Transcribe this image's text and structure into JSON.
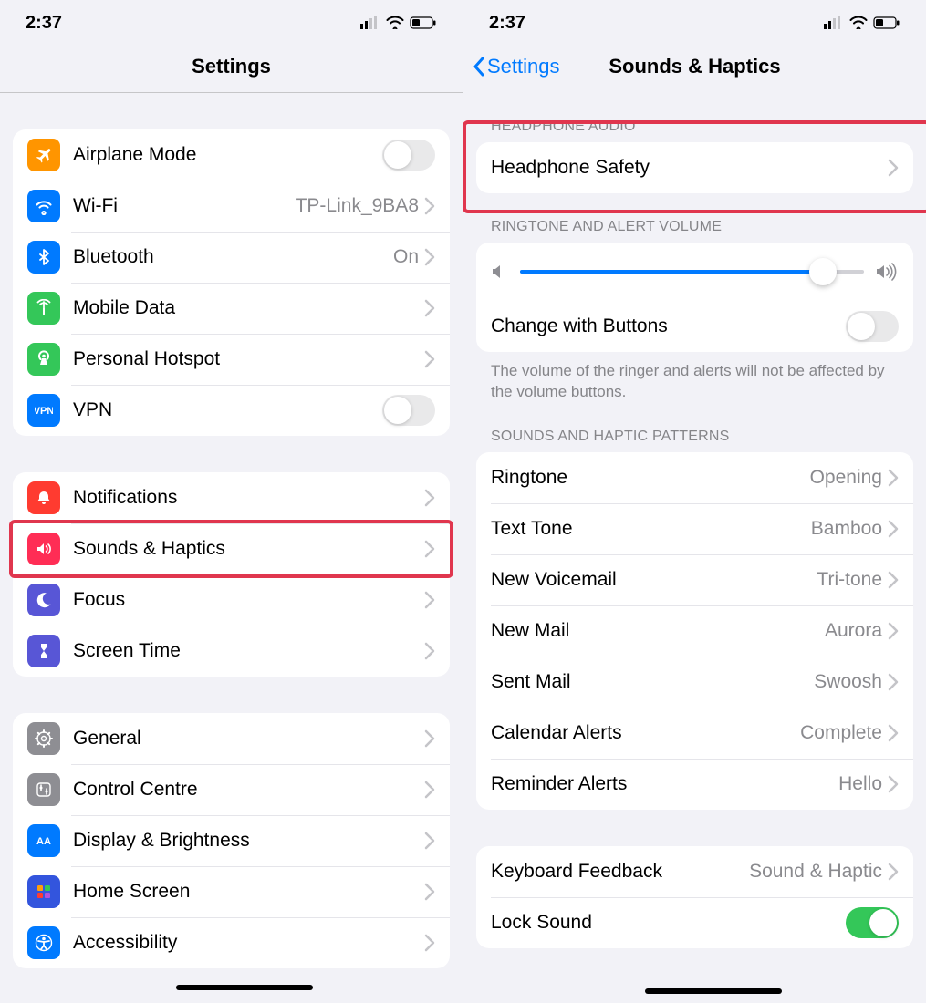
{
  "status": {
    "time": "2:37"
  },
  "left": {
    "title": "Settings",
    "groups": [
      {
        "rows": [
          {
            "key": "airplane",
            "label": "Airplane Mode",
            "type": "toggle",
            "on": false,
            "iconColor": "#ff9500"
          },
          {
            "key": "wifi",
            "label": "Wi-Fi",
            "type": "link",
            "value": "TP-Link_9BA8",
            "iconColor": "#007aff"
          },
          {
            "key": "bluetooth",
            "label": "Bluetooth",
            "type": "link",
            "value": "On",
            "iconColor": "#007aff"
          },
          {
            "key": "mobiledata",
            "label": "Mobile Data",
            "type": "link",
            "iconColor": "#34c759"
          },
          {
            "key": "hotspot",
            "label": "Personal Hotspot",
            "type": "link",
            "iconColor": "#34c759"
          },
          {
            "key": "vpn",
            "label": "VPN",
            "type": "toggle",
            "on": false,
            "iconColor": "#007aff",
            "iconText": "VPN"
          }
        ]
      },
      {
        "rows": [
          {
            "key": "notifications",
            "label": "Notifications",
            "type": "link",
            "iconColor": "#ff3b30"
          },
          {
            "key": "sounds",
            "label": "Sounds & Haptics",
            "type": "link",
            "iconColor": "#ff2d55",
            "highlight": true
          },
          {
            "key": "focus",
            "label": "Focus",
            "type": "link",
            "iconColor": "#5856d6"
          },
          {
            "key": "screentime",
            "label": "Screen Time",
            "type": "link",
            "iconColor": "#5856d6"
          }
        ]
      },
      {
        "rows": [
          {
            "key": "general",
            "label": "General",
            "type": "link",
            "iconColor": "#8e8e93"
          },
          {
            "key": "controlcentre",
            "label": "Control Centre",
            "type": "link",
            "iconColor": "#8e8e93"
          },
          {
            "key": "display",
            "label": "Display & Brightness",
            "type": "link",
            "iconColor": "#007aff",
            "iconText": "AA"
          },
          {
            "key": "homescreen",
            "label": "Home Screen",
            "type": "link",
            "iconColor": "#3355dd"
          },
          {
            "key": "accessibility",
            "label": "Accessibility",
            "type": "link",
            "iconColor": "#007aff"
          }
        ]
      }
    ]
  },
  "right": {
    "back": "Settings",
    "title": "Sounds & Haptics",
    "sections": [
      {
        "header": "HEADPHONE AUDIO",
        "rows": [
          {
            "key": "headphonesafety",
            "label": "Headphone Safety",
            "type": "link",
            "highlight": true
          }
        ]
      },
      {
        "header": "RINGTONE AND ALERT VOLUME",
        "slider": {
          "value": 0.88
        },
        "rows": [
          {
            "key": "changewithbuttons",
            "label": "Change with Buttons",
            "type": "toggle",
            "on": false
          }
        ],
        "footer": "The volume of the ringer and alerts will not be affected by the volume buttons."
      },
      {
        "header": "SOUNDS AND HAPTIC PATTERNS",
        "rows": [
          {
            "key": "ringtone",
            "label": "Ringtone",
            "type": "link",
            "value": "Opening"
          },
          {
            "key": "texttone",
            "label": "Text Tone",
            "type": "link",
            "value": "Bamboo"
          },
          {
            "key": "newvoicemail",
            "label": "New Voicemail",
            "type": "link",
            "value": "Tri-tone"
          },
          {
            "key": "newmail",
            "label": "New Mail",
            "type": "link",
            "value": "Aurora"
          },
          {
            "key": "sentmail",
            "label": "Sent Mail",
            "type": "link",
            "value": "Swoosh"
          },
          {
            "key": "calendaralerts",
            "label": "Calendar Alerts",
            "type": "link",
            "value": "Complete"
          },
          {
            "key": "reminderalerts",
            "label": "Reminder Alerts",
            "type": "link",
            "value": "Hello"
          }
        ]
      },
      {
        "rows": [
          {
            "key": "keyboardfeedback",
            "label": "Keyboard Feedback",
            "type": "link",
            "value": "Sound & Haptic"
          },
          {
            "key": "locksound",
            "label": "Lock Sound",
            "type": "toggle",
            "on": true
          }
        ]
      }
    ]
  }
}
